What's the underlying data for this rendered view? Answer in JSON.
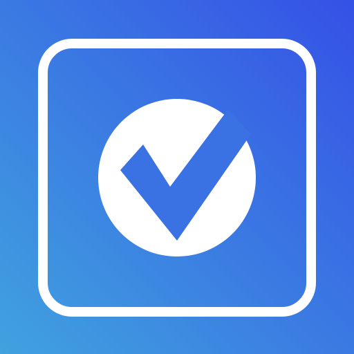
{
  "icon": {
    "name": "checkmark-app-icon",
    "symbol": "check-circle-in-rounded-square",
    "colors": {
      "gradient_bottom_left": "#40A2DF",
      "gradient_top_right": "#3551E6",
      "frame": "#FFFFFF",
      "circle": "#FFFFFF",
      "check": "#3A71E3"
    }
  }
}
